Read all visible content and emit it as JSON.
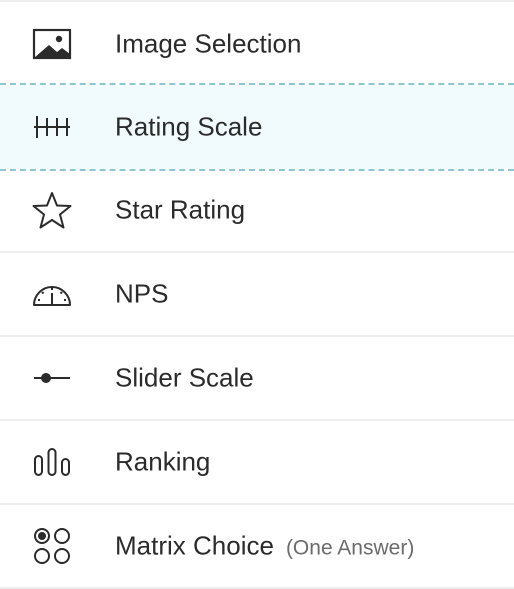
{
  "items": [
    {
      "label": "Image Selection",
      "icon": "image-icon"
    },
    {
      "label": "Rating Scale",
      "icon": "rating-scale-icon"
    },
    {
      "label": "Star Rating",
      "icon": "star-icon"
    },
    {
      "label": "NPS",
      "icon": "gauge-icon"
    },
    {
      "label": "Slider Scale",
      "icon": "slider-icon"
    },
    {
      "label": "Ranking",
      "icon": "ranking-bars-icon"
    },
    {
      "label": "Matrix Choice",
      "sub": "(One Answer)",
      "icon": "matrix-radio-icon"
    }
  ],
  "colors": {
    "text": "#2b2b2b",
    "subtext": "#6b6b6b",
    "divider": "#eeeeee",
    "highlight_bg": "#f1fbfd",
    "highlight_dash": "#8cc7d1"
  }
}
